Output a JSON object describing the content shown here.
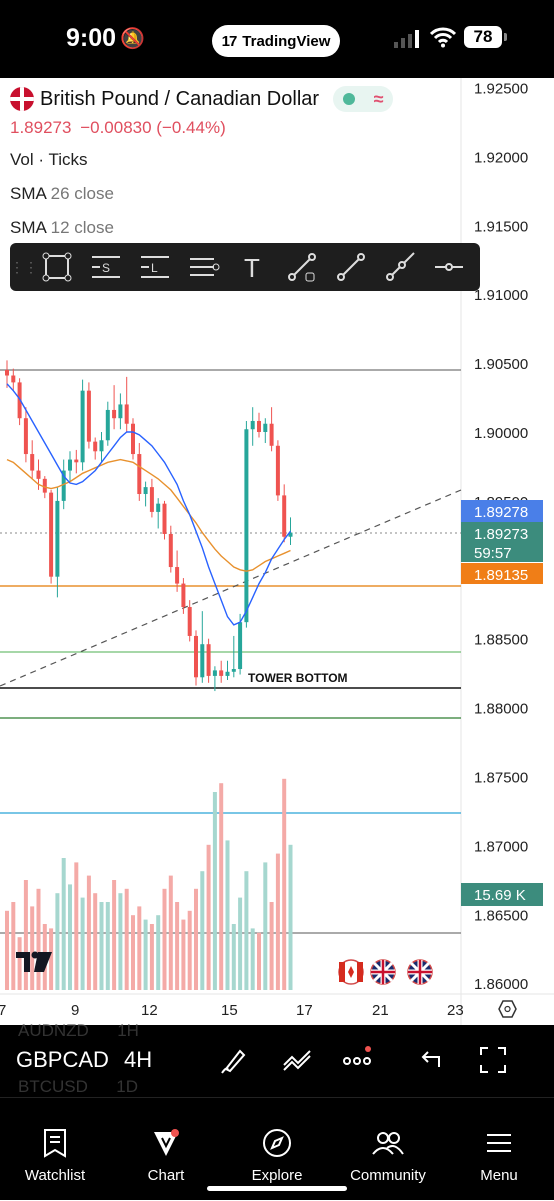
{
  "status_bar": {
    "time": "9:00",
    "app_pill": "TradingView",
    "battery": "78"
  },
  "header": {
    "title": "British Pound / Canadian Dollar",
    "price": "1.89273",
    "change": "−0.00830 (−0.44%)",
    "legend": [
      {
        "name": "Vol",
        "params": "Ticks"
      },
      {
        "name": "SMA",
        "params": "26 close"
      },
      {
        "name": "SMA",
        "params": "12 close"
      }
    ]
  },
  "drawing_toolbar": {
    "tools": [
      "rectangle-icon",
      "parallel-channel-icon",
      "long-position-icon",
      "horizontal-lines-icon",
      "text-icon",
      "trendline-anchor-icon",
      "trendline-icon",
      "ray-icon",
      "horizontal-ray-icon"
    ]
  },
  "colors": {
    "up": "#26a69a",
    "down": "#ef5350",
    "sma26": "#e8912e",
    "sma12": "#2962ff",
    "price_badge": "#3c8c7d",
    "sma26_badge": "#f07e17",
    "sma12_badge": "#4a7fe8"
  },
  "chart_data": {
    "type": "candlestick",
    "symbol": "GBPCAD",
    "timeframe": "4H",
    "y_axis": {
      "ticks": [
        "1.92500",
        "1.92000",
        "1.91500",
        "1.91000",
        "1.90500",
        "1.90000",
        "1.89500",
        "1.89000",
        "1.88500",
        "1.88000",
        "1.87500",
        "1.87000",
        "1.86500",
        "1.86000"
      ],
      "range": [
        1.858,
        1.9265
      ]
    },
    "x_axis": {
      "ticks": [
        "7",
        "9",
        "12",
        "15",
        "17",
        "21",
        "23"
      ]
    },
    "badges": {
      "sma12": "1.89278",
      "price": "1.89273",
      "countdown": "59:57",
      "sma26": "1.89135",
      "volume": "15.69 K"
    },
    "annotation": "TOWER BOTTOM",
    "candles": [
      [
        1.9045,
        1.9052,
        1.9032,
        1.9041
      ],
      [
        1.9041,
        1.9046,
        1.903,
        1.9036
      ],
      [
        1.9036,
        1.9039,
        1.9005,
        1.901
      ],
      [
        1.901,
        1.9018,
        1.8978,
        1.8984
      ],
      [
        1.8984,
        1.8994,
        1.8966,
        1.8972
      ],
      [
        1.8972,
        1.898,
        1.8958,
        1.8966
      ],
      [
        1.8966,
        1.8968,
        1.8952,
        1.8956
      ],
      [
        1.8956,
        1.8958,
        1.889,
        1.8895
      ],
      [
        1.8895,
        1.896,
        1.888,
        1.895
      ],
      [
        1.895,
        1.898,
        1.8944,
        1.8972
      ],
      [
        1.8972,
        1.8986,
        1.8964,
        1.898
      ],
      [
        1.898,
        1.8987,
        1.897,
        1.8978
      ],
      [
        1.8978,
        1.9038,
        1.8972,
        1.903
      ],
      [
        1.903,
        1.9036,
        1.8988,
        1.8993
      ],
      [
        1.8993,
        1.8996,
        1.898,
        1.8986
      ],
      [
        1.8986,
        1.9,
        1.8978,
        1.8994
      ],
      [
        1.8994,
        1.9022,
        1.899,
        1.9016
      ],
      [
        1.9016,
        1.9034,
        1.9002,
        1.901
      ],
      [
        1.901,
        1.9028,
        1.9002,
        1.902
      ],
      [
        1.902,
        1.904,
        1.9,
        1.9006
      ],
      [
        1.9006,
        1.901,
        1.898,
        1.8984
      ],
      [
        1.8984,
        1.8992,
        1.895,
        1.8955
      ],
      [
        1.8955,
        1.8964,
        1.8946,
        1.896
      ],
      [
        1.896,
        1.8966,
        1.8938,
        1.8942
      ],
      [
        1.8942,
        1.8952,
        1.893,
        1.8948
      ],
      [
        1.8948,
        1.895,
        1.8922,
        1.8926
      ],
      [
        1.8926,
        1.8932,
        1.8898,
        1.8902
      ],
      [
        1.8902,
        1.8914,
        1.8884,
        1.889
      ],
      [
        1.889,
        1.8894,
        1.8868,
        1.8873
      ],
      [
        1.8873,
        1.8878,
        1.8848,
        1.8852
      ],
      [
        1.8852,
        1.8856,
        1.8816,
        1.8822
      ],
      [
        1.8822,
        1.887,
        1.8818,
        1.8846
      ],
      [
        1.8846,
        1.885,
        1.8818,
        1.8823
      ],
      [
        1.8823,
        1.883,
        1.8812,
        1.8827
      ],
      [
        1.8827,
        1.8834,
        1.8818,
        1.8823
      ],
      [
        1.8823,
        1.8834,
        1.882,
        1.8826
      ],
      [
        1.8826,
        1.8852,
        1.8822,
        1.8828
      ],
      [
        1.8828,
        1.8868,
        1.8824,
        1.8862
      ],
      [
        1.8862,
        1.9008,
        1.8858,
        1.9002
      ],
      [
        1.9002,
        1.9018,
        1.899,
        1.9008
      ],
      [
        1.9008,
        1.9014,
        1.8996,
        1.9
      ],
      [
        1.9,
        1.901,
        1.8992,
        1.9006
      ],
      [
        1.9006,
        1.9018,
        1.8986,
        1.899
      ],
      [
        1.899,
        1.8994,
        1.895,
        1.8954
      ],
      [
        1.8954,
        1.8962,
        1.892,
        1.8924
      ],
      [
        1.8924,
        1.8938,
        1.8918,
        1.8927
      ]
    ],
    "volumes": [
      18,
      20,
      12,
      25,
      19,
      23,
      15,
      14,
      22,
      30,
      24,
      29,
      21,
      26,
      22,
      20,
      20,
      25,
      22,
      23,
      17,
      19,
      16,
      15,
      17,
      23,
      26,
      20,
      16,
      18,
      23,
      27,
      33,
      45,
      47,
      34,
      15,
      21,
      27,
      14,
      13,
      29,
      20,
      31,
      48,
      33
    ],
    "sma12": [
      1.9035,
      1.903,
      1.9024,
      1.9016,
      1.9008,
      1.9,
      1.8992,
      1.8984,
      1.8976,
      1.8968,
      1.8963,
      1.8962,
      1.8964,
      1.8968,
      1.8972,
      1.8978,
      1.8984,
      1.899,
      1.8996,
      1.9,
      1.9,
      1.8998,
      1.8994,
      1.899,
      1.8984,
      1.8978,
      1.897,
      1.8962,
      1.895,
      1.894,
      1.8928,
      1.8916,
      1.8902,
      1.889,
      1.8878,
      1.8866,
      1.886,
      1.8862,
      1.887,
      1.888,
      1.889,
      1.8898,
      1.8908,
      1.8915,
      1.8922,
      1.8928
    ],
    "sma26": [
      1.898,
      1.8978,
      1.8974,
      1.897,
      1.8966,
      1.8962,
      1.896,
      1.8959,
      1.896,
      1.8962,
      1.8964,
      1.8967,
      1.897,
      1.8972,
      1.8974,
      1.8976,
      1.8978,
      1.8979,
      1.898,
      1.8979,
      1.8978,
      1.8975,
      1.8972,
      1.8969,
      1.8966,
      1.8962,
      1.8958,
      1.8952,
      1.8946,
      1.894,
      1.8934,
      1.8927,
      1.8921,
      1.8915,
      1.891,
      1.8906,
      1.8902,
      1.89,
      1.8899,
      1.89,
      1.8903,
      1.8906,
      1.8908,
      1.891,
      1.8912,
      1.8914
    ]
  },
  "bottom_bar": {
    "symbol": "GBPCAD",
    "timeframe": "4H",
    "watchlist_above": {
      "symbol": "AUDNZD",
      "tf": "1H"
    },
    "watchlist_below": {
      "symbol": "BTCUSD",
      "tf": "1D"
    },
    "tabs": [
      "Watchlist",
      "Chart",
      "Explore",
      "Community",
      "Menu"
    ]
  }
}
